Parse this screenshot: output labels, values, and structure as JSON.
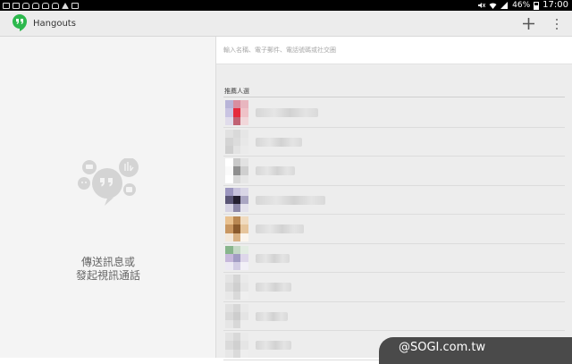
{
  "status_bar": {
    "battery": "46%",
    "time": "17:00"
  },
  "app": {
    "title": "Hangouts",
    "add_icon": "plus-icon",
    "more_icon": "overflow-menu-icon",
    "logo_icon": "hangouts-logo-icon"
  },
  "empty_state": {
    "line1": "傳送訊息或",
    "line2": "發起視訊通話",
    "illustration_icon": "chat-bubbles-icon"
  },
  "search": {
    "placeholder": "輸入名稱、電子郵件、電話號碼或社交圈"
  },
  "contacts": {
    "section_title": "推薦人選",
    "items": [
      {
        "avatar_colors": [
          "#b8b4d8",
          "#d88ea0",
          "#e8b6bf",
          "#c9c4e2",
          "#e52a3d",
          "#efc2c8",
          "#e0dceb",
          "#c16274",
          "#f1d7da"
        ]
      },
      {
        "avatar_colors": [
          "#e1e1e1",
          "#d9d9d9",
          "#e6e6e6",
          "#d4d4d4",
          "#dcdcdc",
          "#e8e8e8",
          "#cfcfcf",
          "#e3e3e3",
          "#ebebeb"
        ]
      },
      {
        "avatar_colors": [
          "#ffffff",
          "#c9c9c9",
          "#e2e2e2",
          "#fafafa",
          "#8f8f8f",
          "#cfcfcf",
          "#ffffff",
          "#d8d8d8",
          "#e6e6e6"
        ]
      },
      {
        "avatar_colors": [
          "#9c96bf",
          "#c7c2dc",
          "#d9d6e6",
          "#5a5575",
          "#241f30",
          "#aaa6c2",
          "#d6d3e3",
          "#8d88a8",
          "#e4e2ec"
        ]
      },
      {
        "avatar_colors": [
          "#e9c18f",
          "#b98752",
          "#f0dbc0",
          "#c99762",
          "#8a5a2d",
          "#e6c59c",
          "#f3e8da",
          "#d8b184",
          "#fbf5ee"
        ]
      },
      {
        "avatar_colors": [
          "#88b58c",
          "#c4d8c5",
          "#e2ece2",
          "#c7b8db",
          "#a29cc3",
          "#ded7ea",
          "#ece9f3",
          "#d3cde4",
          "#f2f0f7"
        ]
      },
      {
        "avatar_colors": [
          "#e4e4e4",
          "#d5d5d5",
          "#eaeaea",
          "#dcdcdc",
          "#cfcfcf",
          "#e6e6e6",
          "#e8e8e8",
          "#d9d9d9",
          "#efefef"
        ]
      },
      {
        "avatar_colors": [
          "#e1e1e1",
          "#d6d6d6",
          "#e9e9e9",
          "#d9d9d9",
          "#cdcdcd",
          "#e4e4e4",
          "#e6e6e6",
          "#d8d8d8",
          "#ededed"
        ]
      },
      {
        "avatar_colors": [
          "#e3e3e3",
          "#d8d8d8",
          "#eaeaea",
          "#dadada",
          "#d0d0d0",
          "#e5e5e5",
          "#e7e7e7",
          "#dadada",
          "#eeeeee"
        ]
      }
    ]
  },
  "watermark": {
    "text": "@SOGI.com.tw"
  }
}
